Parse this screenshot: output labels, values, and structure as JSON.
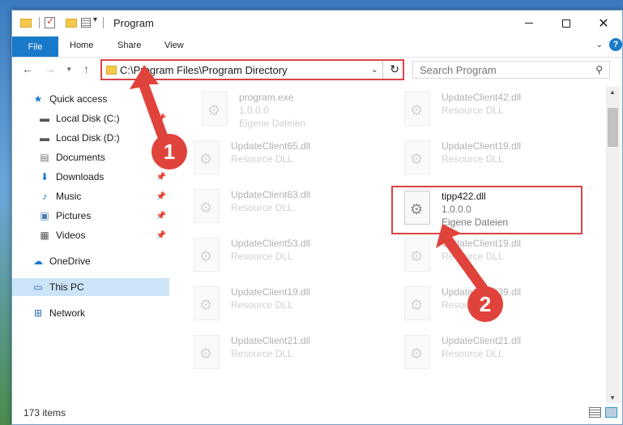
{
  "window": {
    "title": "Program"
  },
  "ribbon": {
    "file": "File",
    "tabs": [
      "Home",
      "Share",
      "View"
    ]
  },
  "address": {
    "path": "C:\\Program Files\\Program Directory"
  },
  "search": {
    "placeholder": "Search Program"
  },
  "nav": {
    "quick_access": "Quick access",
    "local_c": "Local Disk (C:)",
    "local_d": "Local Disk (D:)",
    "documents": "Documents",
    "downloads": "Downloads",
    "music": "Music",
    "pictures": "Pictures",
    "videos": "Videos",
    "onedrive": "OneDrive",
    "thispc": "This PC",
    "network": "Network"
  },
  "files": {
    "f1": {
      "name": "program.exe",
      "line2": "1.0.0.0",
      "line3": "Eigene Dateien"
    },
    "f2": {
      "name": "UpdateClient42.dll",
      "line2": "Resource DLL"
    },
    "f3": {
      "name": "UpdateClient65.dll",
      "line2": "Resource DLL"
    },
    "f4": {
      "name": "UpdateClient19.dll",
      "line2": "Resource DLL"
    },
    "f5": {
      "name": "UpdateClient63.dll",
      "line2": "Resource DLL"
    },
    "target": {
      "name": "tipp422.dll",
      "line2": "1.0.0.0",
      "line3": "Eigene Dateien"
    },
    "f7": {
      "name": "UpdateClient53.dll",
      "line2": "Resource DLL"
    },
    "f8": {
      "name": "UpdateClient19.dll",
      "line2": "Resource DLL"
    },
    "f9": {
      "name": "UpdateClient19.dll",
      "line2": "Resource DLL"
    },
    "f10": {
      "name": "UpdateClient39.dll",
      "line2": "Resource DLL"
    },
    "f11": {
      "name": "UpdateClient21.dll",
      "line2": "Resource DLL"
    },
    "f12": {
      "name": "UpdateClient21.dll",
      "line2": "Resource DLL"
    }
  },
  "status": {
    "count": "173 items"
  },
  "markers": {
    "m1": "1",
    "m2": "2"
  },
  "colors": {
    "accent": "#1979ca",
    "highlight": "#d94545",
    "marker": "#e0433b"
  }
}
